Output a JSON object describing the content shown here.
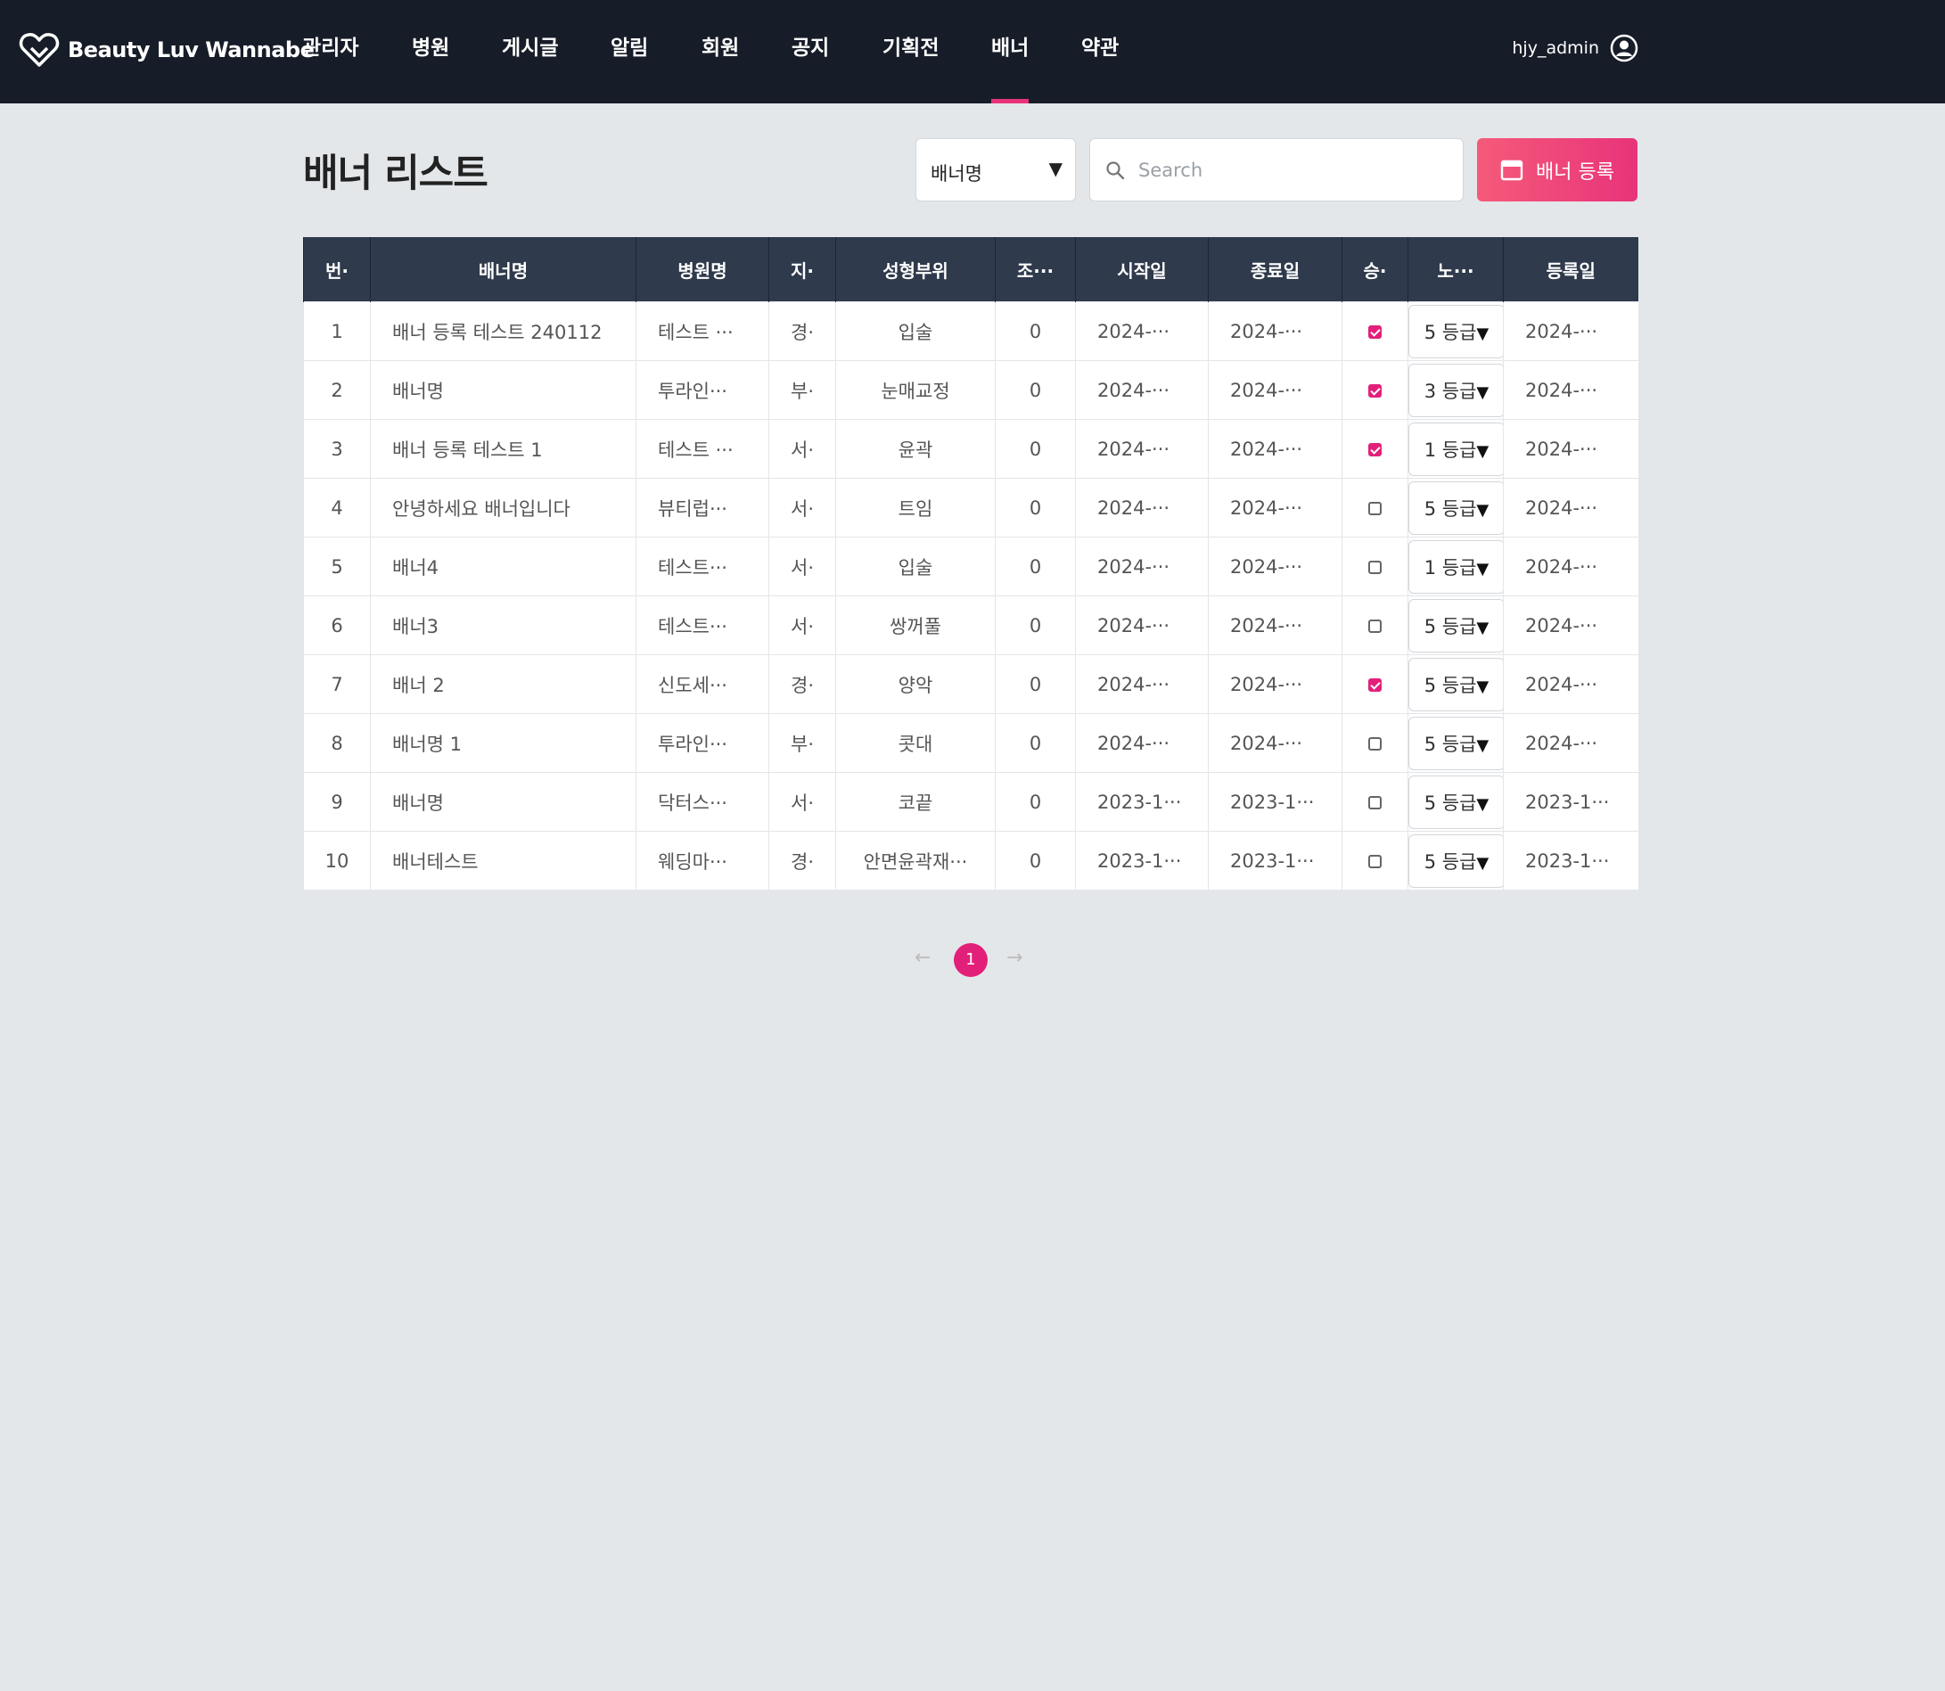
{
  "app": {
    "brand": "Beauty Luv Wannabe",
    "user": "hjy_admin",
    "accent": "#e8337a",
    "nav": [
      "관리자",
      "병원",
      "게시글",
      "알림",
      "회원",
      "공지",
      "기획전",
      "배너",
      "약관"
    ],
    "active_nav": "배너"
  },
  "page": {
    "title": "배너 리스트",
    "filter_value": "배너명",
    "search_placeholder": "Search",
    "add_button": "배너 등록"
  },
  "table": {
    "headers": [
      "번·",
      "배너명",
      "병원명",
      "지·",
      "성형부위",
      "조···",
      "시작일",
      "종료일",
      "승·",
      "노···",
      "등록일"
    ],
    "rows": [
      {
        "no": "1",
        "name": "배너 등록 테스트 240112",
        "hospital": "테스트 ···",
        "region": "경·",
        "part": "입술",
        "views": "0",
        "start": "2024-···",
        "end": "2024-···",
        "approved": true,
        "grade": "5 등급",
        "registered": "2024-···"
      },
      {
        "no": "2",
        "name": "배너명",
        "hospital": "투라인···",
        "region": "부·",
        "part": "눈매교정",
        "views": "0",
        "start": "2024-···",
        "end": "2024-···",
        "approved": true,
        "grade": "3 등급",
        "registered": "2024-···"
      },
      {
        "no": "3",
        "name": "배너 등록 테스트 1",
        "hospital": "테스트 ···",
        "region": "서·",
        "part": "윤곽",
        "views": "0",
        "start": "2024-···",
        "end": "2024-···",
        "approved": true,
        "grade": "1 등급",
        "registered": "2024-···"
      },
      {
        "no": "4",
        "name": "안녕하세요 배너입니다",
        "hospital": "뷰티럽···",
        "region": "서·",
        "part": "트임",
        "views": "0",
        "start": "2024-···",
        "end": "2024-···",
        "approved": false,
        "grade": "5 등급",
        "registered": "2024-···"
      },
      {
        "no": "5",
        "name": "배너4",
        "hospital": "테스트···",
        "region": "서·",
        "part": "입술",
        "views": "0",
        "start": "2024-···",
        "end": "2024-···",
        "approved": false,
        "grade": "1 등급",
        "registered": "2024-···"
      },
      {
        "no": "6",
        "name": "배너3",
        "hospital": "테스트···",
        "region": "서·",
        "part": "쌍꺼풀",
        "views": "0",
        "start": "2024-···",
        "end": "2024-···",
        "approved": false,
        "grade": "5 등급",
        "registered": "2024-···"
      },
      {
        "no": "7",
        "name": "배너 2",
        "hospital": "신도세···",
        "region": "경·",
        "part": "양악",
        "views": "0",
        "start": "2024-···",
        "end": "2024-···",
        "approved": true,
        "grade": "5 등급",
        "registered": "2024-···"
      },
      {
        "no": "8",
        "name": "배너명 1",
        "hospital": "투라인···",
        "region": "부·",
        "part": "콧대",
        "views": "0",
        "start": "2024-···",
        "end": "2024-···",
        "approved": false,
        "grade": "5 등급",
        "registered": "2024-···"
      },
      {
        "no": "9",
        "name": "배너명",
        "hospital": "닥터스···",
        "region": "서·",
        "part": "코끝",
        "views": "0",
        "start": "2023-1···",
        "end": "2023-1···",
        "approved": false,
        "grade": "5 등급",
        "registered": "2023-1···"
      },
      {
        "no": "10",
        "name": "배너테스트",
        "hospital": "웨딩마···",
        "region": "경·",
        "part": "안면윤곽재···",
        "views": "0",
        "start": "2023-1···",
        "end": "2023-1···",
        "approved": false,
        "grade": "5 등급",
        "registered": "2023-1···"
      }
    ]
  },
  "pagination": {
    "current": "1",
    "prev_icon": "arrow-left-icon",
    "next_icon": "arrow-right-icon"
  }
}
